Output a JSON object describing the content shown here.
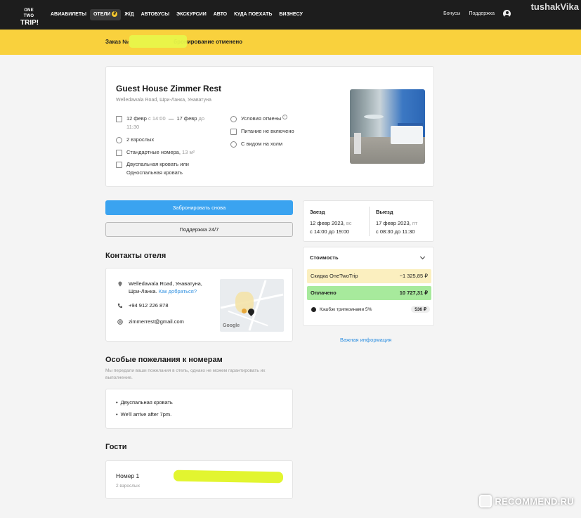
{
  "watermarks": {
    "top": "tushakVika",
    "bottom": "RECOMMEND.RU"
  },
  "header": {
    "logo_line1": "ONE TWO",
    "logo_line2": "TRIP!",
    "nav": [
      {
        "label": "АВИАБИЛЕТЫ"
      },
      {
        "label": "ОТЕЛИ",
        "active": true,
        "badge": "₽"
      },
      {
        "label": "Ж/Д"
      },
      {
        "label": "АВТОБУСЫ"
      },
      {
        "label": "ЭКСКУРСИИ"
      },
      {
        "label": "АВТО"
      },
      {
        "label": "КУДА ПОЕХАТЬ"
      },
      {
        "label": "БИЗНЕСУ"
      }
    ],
    "bonuses": "Бонусы",
    "support": "Поддержка"
  },
  "banner": {
    "text": "Заказ № ················· бронирование отменено",
    "prefix": "Заказ №",
    "suffix": "бронирование отменено"
  },
  "hotel": {
    "name": "Guest House Zimmer Rest",
    "address": "Welledawala Road, Шри-Ланка, Унаватуна",
    "dates_from": "12 февр",
    "time_from": "с 14:00",
    "dash": "—",
    "dates_to": "17 февр",
    "time_to_prefix": "до",
    "time_to": "11:30",
    "guests": "2 взрослых",
    "room": "Стандартные номера,",
    "room_size": "13 м²",
    "bed_line1": "Двуспальная кровать или",
    "bed_line2": "Односпальная кровать",
    "cancel_conditions": "Условия отмены",
    "meals": "Питание не включено",
    "view": "С видом на холм"
  },
  "actions": {
    "book_again": "Забронировать снова",
    "support": "Поддержка 24/7"
  },
  "contacts": {
    "title": "Контакты отеля",
    "address_line1": "Welledawala Road, Унаватуна,",
    "address_line2": "Шри-Ланка.",
    "directions": "Как добраться?",
    "phone": "+94 912 226 878",
    "email": "zimmerrest@gmail.com",
    "map_brand": "Google"
  },
  "wishes": {
    "title": "Особые пожелания к номерам",
    "note": "Мы передали ваши пожелания в отель, однако не можем гарантировать их выполнение.",
    "items": [
      "Двуспальная кровать",
      "We'll arrive after 7pm."
    ]
  },
  "guests": {
    "title": "Гости",
    "room_label": "Номер 1",
    "room_guests": "2 взрослых"
  },
  "stay": {
    "checkin_label": "Заезд",
    "checkin_date": "12 февр 2023,",
    "checkin_day": "вс",
    "checkin_time": "с 14:00 до 19:00",
    "checkout_label": "Выезд",
    "checkout_date": "17 февр 2023,",
    "checkout_day": "пт",
    "checkout_time": "с 08:30 до 11:30"
  },
  "cost": {
    "title": "Стоимость",
    "discount_label": "Скидка OneTwoTrip",
    "discount_value": "−1 325,85 ₽",
    "paid_label": "Оплачено",
    "paid_value": "10 727,31 ₽",
    "cashback_label": "Кэшбэк трипкоинами 5%",
    "cashback_value": "536 ₽"
  },
  "important_info": "Важная информация",
  "colors": {
    "header_bg": "#1d1d1d",
    "banner_bg": "#f9d13d",
    "primary": "#3aa3f0",
    "paid_bg": "#a7ea9c",
    "discount_bg": "#fbefbf",
    "link": "#2d8fe0"
  }
}
